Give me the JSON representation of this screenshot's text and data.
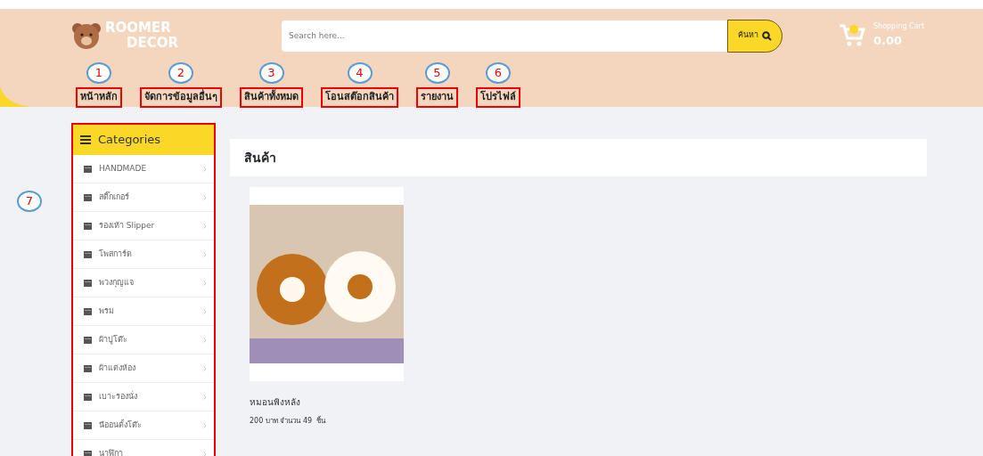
{
  "header": {
    "logo": {
      "line1": "ROOMER",
      "line2": "DECOR"
    },
    "search": {
      "placeholder": "Search here...",
      "button": "ค้นหา"
    },
    "cart": {
      "label": "Shopping Cart",
      "total": "0.00"
    }
  },
  "nav": [
    {
      "label": "หน้าหลัก",
      "callout": "1"
    },
    {
      "label": "จัดการข้อมูลอื่นๆ",
      "callout": "2"
    },
    {
      "label": "สินค้าทั้งหมด",
      "callout": "3"
    },
    {
      "label": "โอนสต๊อกสินค้า",
      "callout": "4"
    },
    {
      "label": "รายงาน",
      "callout": "5"
    },
    {
      "label": "โปรไฟล์",
      "callout": "6"
    }
  ],
  "sidebar": {
    "callout": "7",
    "title": "Categories",
    "items": [
      "HANDMADE",
      "สติ๊กเกอร์",
      "รองเท้า Slipper",
      "โพสการ์ด",
      "พวงกุญแจ",
      "พรม",
      "ผ้าปูโต๊ะ",
      "ผ้าแต่งห้อง",
      "เบาะรองนั่ง",
      "นีออนตั้งโต๊ะ",
      "นาฬิกา"
    ]
  },
  "content": {
    "title": "สินค้า",
    "products": [
      {
        "name": "หมอนพิงหลัง",
        "details": "200 บาท จำนวน 49  ชิ้น"
      }
    ]
  }
}
